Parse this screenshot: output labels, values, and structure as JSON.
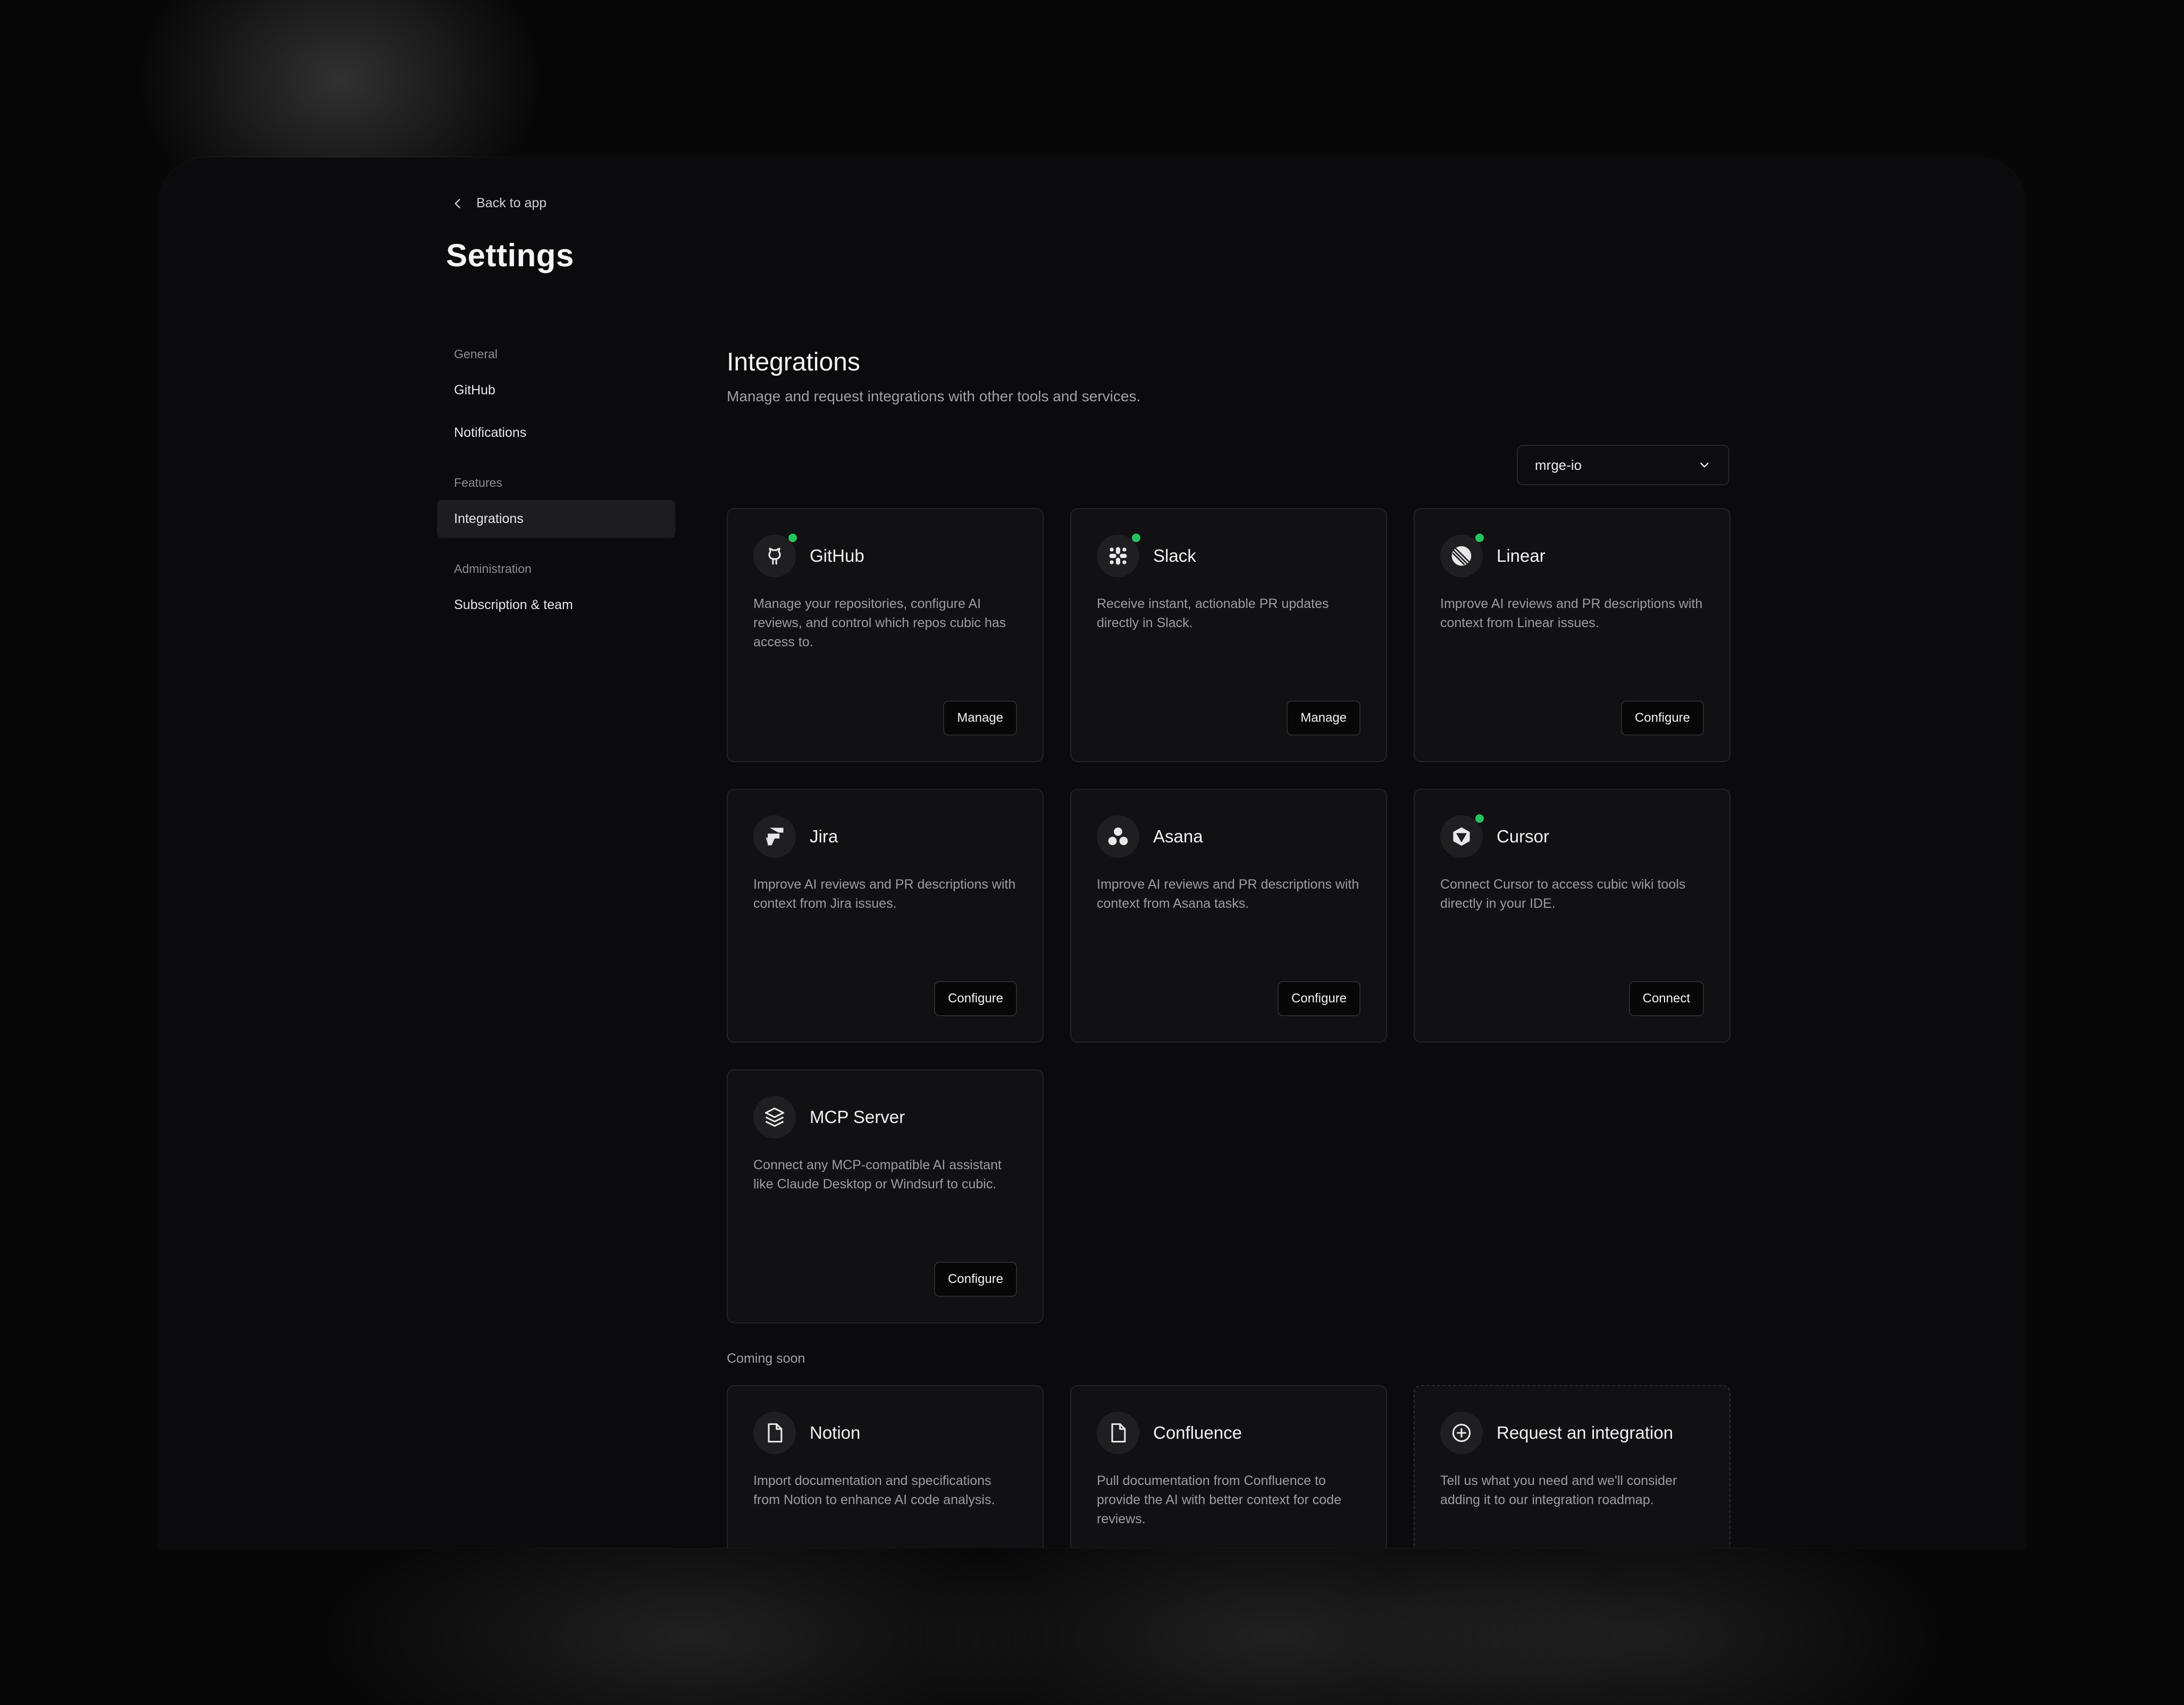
{
  "header": {
    "back_label": "Back to app",
    "title": "Settings"
  },
  "sidebar": {
    "groups": [
      {
        "label": "General",
        "items": [
          {
            "label": "GitHub"
          },
          {
            "label": "Notifications"
          }
        ]
      },
      {
        "label": "Features",
        "items": [
          {
            "label": "Integrations",
            "active": true
          }
        ]
      },
      {
        "label": "Administration",
        "items": [
          {
            "label": "Subscription & team"
          }
        ]
      }
    ]
  },
  "main": {
    "title": "Integrations",
    "subtitle": "Manage and request integrations with other tools and services.",
    "org_select": {
      "value": "mrge-io"
    },
    "integrations": [
      {
        "name": "GitHub",
        "icon": "github-icon",
        "connected": true,
        "description": "Manage your repositories, configure AI reviews, and control which repos cubic has access to.",
        "button": "Manage"
      },
      {
        "name": "Slack",
        "icon": "slack-icon",
        "connected": true,
        "description": "Receive instant, actionable PR updates directly in Slack.",
        "button": "Manage"
      },
      {
        "name": "Linear",
        "icon": "linear-icon",
        "connected": true,
        "description": "Improve AI reviews and PR descriptions with context from Linear issues.",
        "button": "Configure"
      },
      {
        "name": "Jira",
        "icon": "jira-icon",
        "connected": false,
        "description": "Improve AI reviews and PR descriptions with context from Jira issues.",
        "button": "Configure"
      },
      {
        "name": "Asana",
        "icon": "asana-icon",
        "connected": false,
        "description": "Improve AI reviews and PR descriptions with context from Asana tasks.",
        "button": "Configure"
      },
      {
        "name": "Cursor",
        "icon": "cursor-icon",
        "connected": true,
        "description": "Connect Cursor to access cubic wiki tools directly in your IDE.",
        "button": "Connect"
      },
      {
        "name": "MCP Server",
        "icon": "layers-icon",
        "connected": false,
        "description": "Connect any MCP-compatible AI assistant like Claude Desktop or Windsurf to cubic.",
        "button": "Configure"
      }
    ],
    "coming_soon_label": "Coming soon",
    "coming_soon": [
      {
        "name": "Notion",
        "icon": "document-icon",
        "description": "Import documentation and specifications from Notion to enhance AI code analysis."
      },
      {
        "name": "Confluence",
        "icon": "document-icon",
        "description": "Pull documentation from Confluence to provide the AI with better context for code reviews."
      },
      {
        "name": "Request an integration",
        "icon": "plus-circle-icon",
        "description": "Tell us what you need and we'll consider adding it to our integration roadmap."
      }
    ],
    "status_color": "#22c55e"
  }
}
